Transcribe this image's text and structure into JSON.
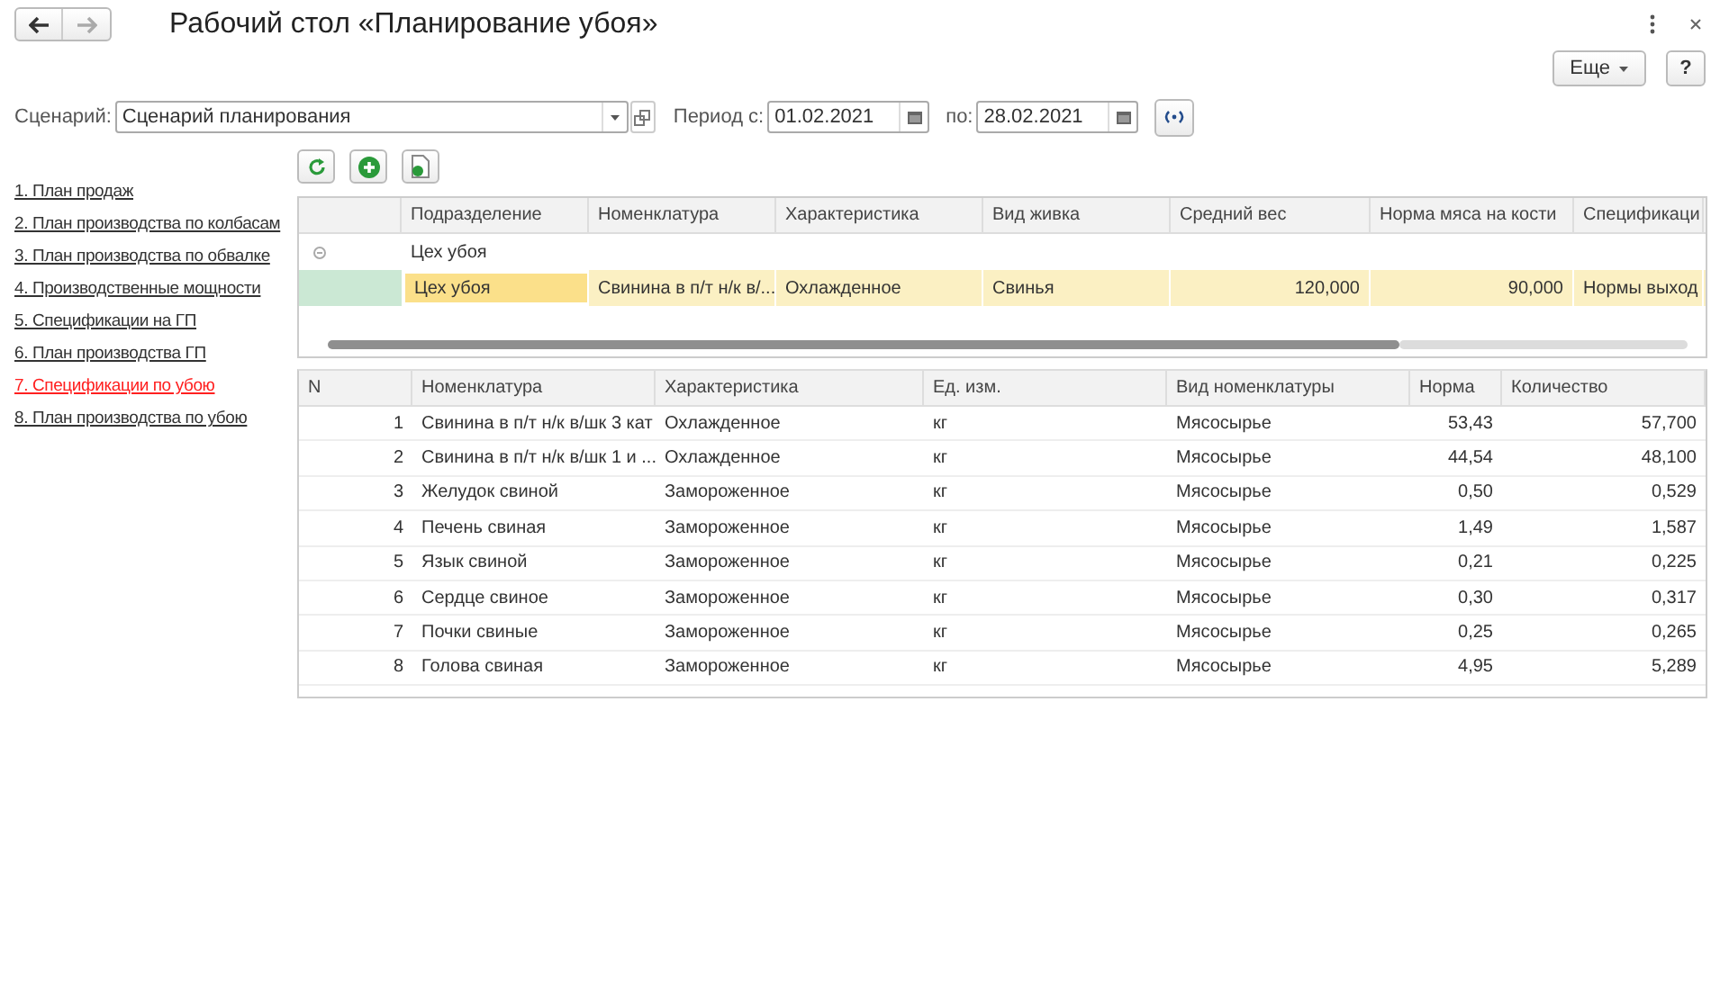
{
  "window": {
    "title": "Рабочий стол «Планирование убоя»"
  },
  "header_buttons": {
    "more": "Еще",
    "help": "?"
  },
  "filters": {
    "scenario_label": "Сценарий:",
    "scenario_value": "Сценарий планирования",
    "period_from_label": "Период с:",
    "period_from_value": "01.02.2021",
    "period_to_label": "по:",
    "period_to_value": "28.02.2021"
  },
  "sidebar": {
    "items": [
      {
        "label": "1. План продаж",
        "selected": false
      },
      {
        "label": "2. План производства по колбасам",
        "selected": false
      },
      {
        "label": "3. План производства по обвалке",
        "selected": false
      },
      {
        "label": "4. Производственные мощности",
        "selected": false
      },
      {
        "label": "5. Спецификации на ГП",
        "selected": false
      },
      {
        "label": "6. План производства ГП",
        "selected": false
      },
      {
        "label": "7. Спецификации по убою",
        "selected": true
      },
      {
        "label": "8. План производства по убою",
        "selected": false
      }
    ]
  },
  "upper_table": {
    "columns": [
      "Подразделение",
      "Номенклатура",
      "Характеристика",
      "Вид живка",
      "Средний вес",
      "Норма мяса на кости",
      "Спецификаци"
    ],
    "group": {
      "label": "Цех убоя",
      "expanded": true
    },
    "rows": [
      {
        "selected": true,
        "cells": [
          "Цех убоя",
          "Свинина в п/т н/к в/...",
          "Охлажденное",
          "Свинья",
          "120,000",
          "90,000",
          "Нормы выход"
        ]
      }
    ]
  },
  "lower_table": {
    "columns": [
      "N",
      "Номенклатура",
      "Характеристика",
      "Ед. изм.",
      "Вид номенклатуры",
      "Норма",
      "Количество"
    ],
    "rows": [
      [
        "1",
        "Свинина в п/т н/к в/шк 3 кат",
        "Охлажденное",
        "кг",
        "Мясосырье",
        "53,43",
        "57,700"
      ],
      [
        "2",
        "Свинина в п/т н/к в/шк 1 и ...",
        "Охлажденное",
        "кг",
        "Мясосырье",
        "44,54",
        "48,100"
      ],
      [
        "3",
        "Желудок свиной",
        "Замороженное",
        "кг",
        "Мясосырье",
        "0,50",
        "0,529"
      ],
      [
        "4",
        "Печень свиная",
        "Замороженное",
        "кг",
        "Мясосырье",
        "1,49",
        "1,587"
      ],
      [
        "5",
        "Язык свиной",
        "Замороженное",
        "кг",
        "Мясосырье",
        "0,21",
        "0,225"
      ],
      [
        "6",
        "Сердце свиное",
        "Замороженное",
        "кг",
        "Мясосырье",
        "0,30",
        "0,317"
      ],
      [
        "7",
        "Почки свиные",
        "Замороженное",
        "кг",
        "Мясосырье",
        "0,25",
        "0,265"
      ],
      [
        "8",
        "Голова свиная",
        "Замороженное",
        "кг",
        "Мясосырье",
        "4,95",
        "5,289"
      ]
    ]
  }
}
